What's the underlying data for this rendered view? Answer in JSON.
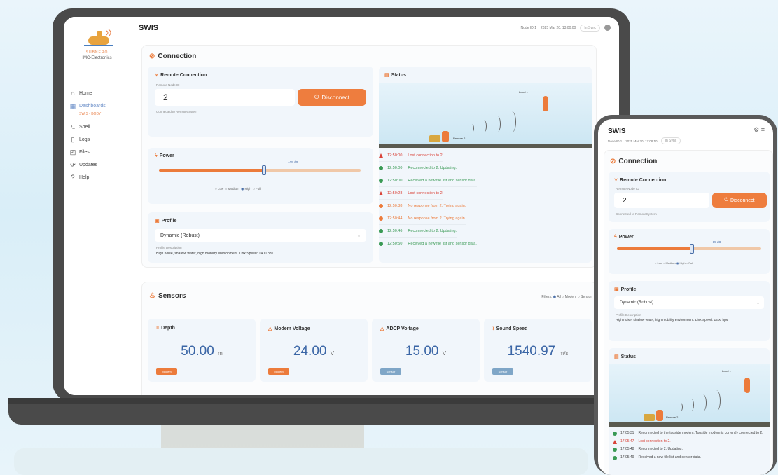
{
  "app": {
    "title": "SWIS",
    "brand": "SUBNERO",
    "brand_sub": "IMC-Electronics"
  },
  "header": {
    "node": "Node ID 1",
    "datetime": "2025 Mar 20, 13:00:00",
    "badge": "In Sync"
  },
  "phone_header": {
    "node": "Node ID 1",
    "datetime": "2025 Mar 20, 17:08:10",
    "badge": "In Sync"
  },
  "nav": [
    {
      "label": "Home",
      "icon": "home-icon",
      "glyph": "⌂"
    },
    {
      "label": "Dashboards",
      "icon": "dashboard-icon",
      "glyph": "▦"
    },
    {
      "label": "Shell",
      "icon": "terminal-icon",
      "glyph": "›_"
    },
    {
      "label": "Logs",
      "icon": "file-icon",
      "glyph": "▯"
    },
    {
      "label": "Files",
      "icon": "folder-icon",
      "glyph": "◰"
    },
    {
      "label": "Updates",
      "icon": "update-icon",
      "glyph": "⟳"
    },
    {
      "label": "Help",
      "icon": "help-icon",
      "glyph": "?"
    }
  ],
  "nav_sub": "SWIS - BODY",
  "connection": {
    "title": "Connection",
    "remote": {
      "title": "Remote Connection",
      "label": "Remote Node ID",
      "value": "2",
      "button": "Disconnect",
      "note": "Connected to RemoteSystem"
    },
    "power": {
      "title": "Power",
      "marker": "~15 dB",
      "options": [
        "Low",
        "Medium",
        "High",
        "Full"
      ],
      "selected": "High",
      "level": 0.52
    },
    "profile": {
      "title": "Profile",
      "value": "Dynamic (Robust)",
      "desc_label": "Profile Description",
      "desc": "High noise, shallow water, high mobility environment. Link Speed: 1400 bps"
    },
    "status": {
      "title": "Status",
      "remote_label": "Local 1",
      "node_label": "Remote 2"
    }
  },
  "logs": [
    {
      "time": "12:50:00",
      "text": "Lost connection to 2.",
      "kind": "error",
      "color": "#d9443a"
    },
    {
      "time": "12:50:00",
      "text": "Reconnected to 2. Updating.",
      "kind": "ok",
      "color": "#3a9a55"
    },
    {
      "time": "12:50:00",
      "text": "Received a new file list and sensor data.",
      "kind": "ok",
      "color": "#3a9a55"
    },
    {
      "time": "12:50:28",
      "text": "Lost connection to 2.",
      "kind": "error",
      "color": "#d9443a"
    },
    {
      "time": "12:50:38",
      "text": "No response from 2. Trying again.",
      "kind": "warn",
      "color": "#ec7b3b"
    },
    {
      "time": "12:50:44",
      "text": "No response from 2. Trying again.",
      "kind": "warn",
      "color": "#ec7b3b"
    },
    {
      "time": "12:50:46",
      "text": "Reconnected to 2. Updating.",
      "kind": "ok",
      "color": "#3a9a55"
    },
    {
      "time": "12:50:50",
      "text": "Received a new file list and sensor data.",
      "kind": "ok",
      "color": "#3a9a55"
    }
  ],
  "sensors": {
    "title": "Sensors",
    "filter_label": "Filters:",
    "filters": [
      "All",
      "Modem",
      "Sensor"
    ],
    "items": [
      {
        "name": "Depth",
        "value": "50.00",
        "unit": "m",
        "tag": "Modem",
        "tag_color": "#ec7b3b"
      },
      {
        "name": "Modem Voltage",
        "value": "24.00",
        "unit": "V",
        "tag": "Modem",
        "tag_color": "#ec7b3b"
      },
      {
        "name": "ADCP Voltage",
        "value": "15.00",
        "unit": "V",
        "tag": "Sensor",
        "tag_color": "#7fa6c7"
      },
      {
        "name": "Sound Speed",
        "value": "1540.97",
        "unit": "m/s",
        "tag": "Sensor",
        "tag_color": "#7fa6c7"
      }
    ]
  },
  "phone_logs": [
    {
      "time": "17:05:31",
      "text": "Reconnected to the topside modem. Topside modem is currently connected to 2.",
      "kind": "ok",
      "color": "#3a9a55"
    },
    {
      "time": "17:05:47",
      "text": "Lost connection to 2.",
      "kind": "error",
      "color": "#d9443a"
    },
    {
      "time": "17:05:48",
      "text": "Reconnected to 2. Updating.",
      "kind": "ok",
      "color": "#3a9a55"
    },
    {
      "time": "17:05:49",
      "text": "Received a new file list and sensor data.",
      "kind": "ok",
      "color": "#3a9a55"
    }
  ],
  "phone_profile_desc": "High noise, shallow water, high mobility environment. Link Speed: 1400 bps"
}
